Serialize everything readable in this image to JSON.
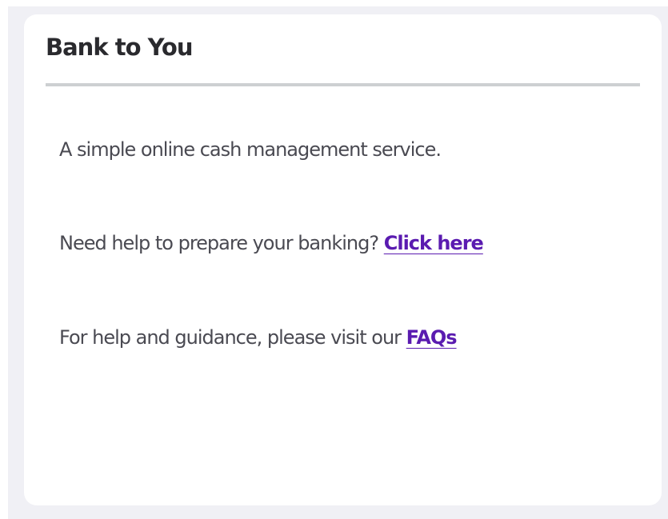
{
  "card": {
    "title": "Bank to You",
    "description": "A simple online cash management service.",
    "help_prompt": "Need help to prepare your banking?",
    "help_link": "Click here",
    "guidance_prompt": "For help and guidance, please visit our",
    "faq_link": "FAQs"
  },
  "colors": {
    "link": "#5a1bb0",
    "text": "#4a4a52",
    "title": "#2a2a2e",
    "divider": "#cdd0d2",
    "background": "#f0f0f5"
  }
}
